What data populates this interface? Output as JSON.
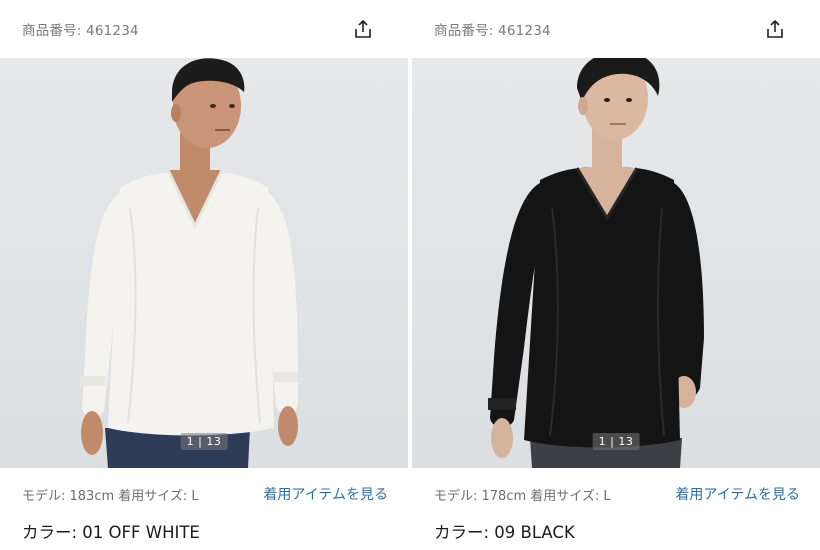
{
  "panels": [
    {
      "product_number": "商品番号: 461234",
      "share_icon": "share-upload-icon",
      "image_description_color": "#f4f3ef",
      "image_counter": "1 | 13",
      "model_info": "モデル: 183cm 着用サイズ: L",
      "outfit_link": "着用アイテムを見る",
      "color_label": "カラー: 01 OFF WHITE"
    },
    {
      "product_number": "商品番号: 461234",
      "share_icon": "share-upload-icon",
      "image_description_color": "#141414",
      "image_counter": "1 | 13",
      "model_info": "モデル: 178cm 着用サイズ: L",
      "outfit_link": "着用アイテムを見る",
      "color_label": "カラー: 09 BLACK"
    }
  ],
  "colors": {
    "link": "#2e6ea6",
    "muted_text": "#7a7a7a",
    "photo_background": "#e0e3e5"
  }
}
